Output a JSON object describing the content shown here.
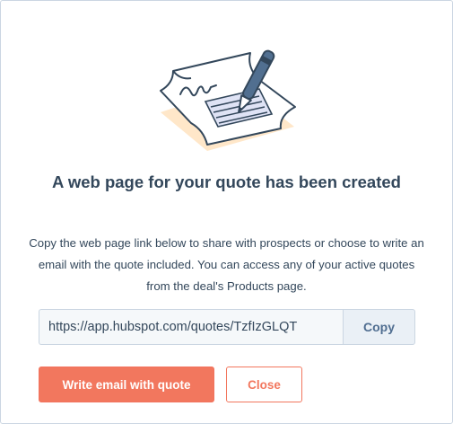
{
  "dialog": {
    "title": "A web page for your quote has been created",
    "description": "Copy the web page link below to share with prospects or choose to write an email with the quote included. You can access any of your active quotes from the deal's Products page.",
    "link_value": "https://app.hubspot.com/quotes/TzfIzGLQT",
    "copy_label": "Copy",
    "write_email_label": "Write email with quote",
    "close_label": "Close",
    "illustration_icon": "signed-document-with-pen-icon"
  },
  "colors": {
    "heading_text": "#33475b",
    "primary_button": "#f2775e",
    "secondary_button_border": "#f2775e",
    "input_background": "#f5f8fa",
    "copy_button_background": "#eaf0f6",
    "copy_button_text": "#506e91",
    "border": "#cbd6e2",
    "illustration_shadow": "#ffe7c9",
    "illustration_fill": "#eef1fa"
  }
}
